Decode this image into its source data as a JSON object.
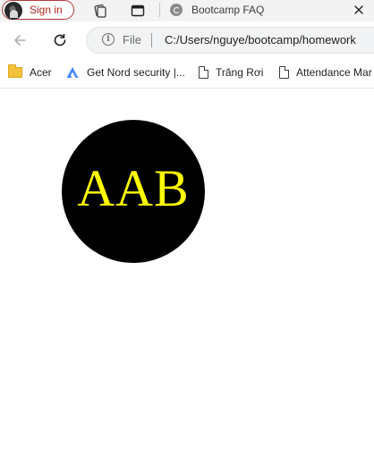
{
  "tabstrip": {
    "signin_label": "Sign in",
    "active_tab_title": "Bootcamp FAQ",
    "icons": [
      "profile-avatar",
      "workspaces-icon",
      "tab-actions-icon",
      "page-favicon",
      "close-icon"
    ]
  },
  "toolbar": {
    "back_icon": "arrow-left",
    "reload_icon": "reload",
    "site_info_label": "File",
    "url": "C:/Users/nguye/bootcamp/homework"
  },
  "bookmarks": [
    {
      "label": "Acer",
      "icon": "folder-icon"
    },
    {
      "label": "Get Nord security |...",
      "icon": "nord-icon"
    },
    {
      "label": "Trăng Rơi",
      "icon": "page-icon"
    },
    {
      "label": "Attendance Mar",
      "icon": "page-icon"
    }
  ],
  "page": {
    "circle_text": "AAB"
  },
  "colors": {
    "circle_fill": "#000000",
    "circle_text": "#ffff00",
    "signin_accent": "#b3261e",
    "folder": "#f2c23a",
    "nord": "#4687ff"
  }
}
